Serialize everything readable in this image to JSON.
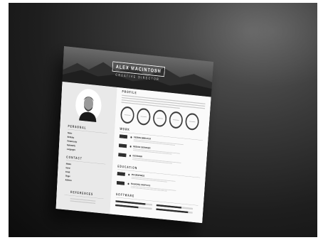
{
  "resume": {
    "name": "ALEX MACINTOSH",
    "role": "CREATIVE DIRECTOR",
    "sections": {
      "profile": "PROFILE",
      "personal": "PERSONAL",
      "contact": "CONTACT",
      "references": "REFERENCES",
      "work": "WORK",
      "education": "EDUCATION",
      "software": "SOFTWARE"
    },
    "personal": [
      {
        "label": "Name"
      },
      {
        "label": "Birthday"
      },
      {
        "label": "Relationship"
      },
      {
        "label": "Nationality"
      },
      {
        "label": "Languages"
      }
    ],
    "contact": [
      {
        "label": "Mobile"
      },
      {
        "label": "Home"
      },
      {
        "label": "Email"
      },
      {
        "label": "Skype"
      },
      {
        "label": "Address"
      }
    ],
    "work": [
      {
        "title": "DESIGN DIRECTOR"
      },
      {
        "title": "DESIGN DESIGNER"
      },
      {
        "title": "DESIGNER"
      }
    ],
    "education": [
      {
        "title": "MA GRAPHICS"
      },
      {
        "title": "BA(HONS) GRAPHICS"
      }
    ]
  },
  "colors": {
    "background": "#1e1e1e",
    "paper": "#f4f4f4",
    "sidebar": "#e9e9e9",
    "accent": "#2e2e2e"
  }
}
